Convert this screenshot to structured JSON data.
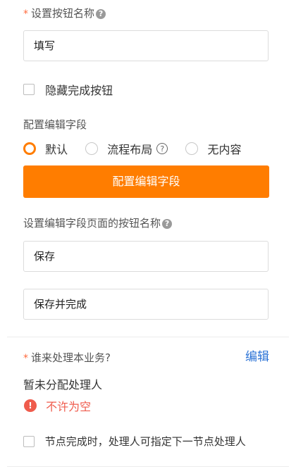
{
  "section_button_name": {
    "required_mark": "*",
    "label": "设置按钮名称",
    "help_icon": "question-circle-icon",
    "input_value": "填写"
  },
  "hide_complete": {
    "label": "隐藏完成按钮",
    "checked": false
  },
  "edit_fields": {
    "label": "配置编辑字段",
    "radios": [
      {
        "label": "默认",
        "checked": true
      },
      {
        "label": "流程布局",
        "checked": false,
        "help_icon": "question-circle-icon"
      },
      {
        "label": "无内容",
        "checked": false
      }
    ],
    "button_label": "配置编辑字段",
    "accent": "#ff7d00"
  },
  "edit_page_buttons": {
    "label": "设置编辑字段页面的按钮名称",
    "help_icon": "question-circle-icon",
    "inputs": [
      "保存",
      "保存并完成"
    ]
  },
  "handler": {
    "required_mark": "*",
    "question": "谁来处理本业务?",
    "edit_link": "编辑",
    "status": "暂未分配处理人",
    "error_icon": "exclamation-circle-icon",
    "error_text": "不许为空",
    "error_color": "#ef5b4c",
    "next_node": {
      "label": "节点完成时，处理人可指定下一节点处理人",
      "checked": false
    }
  }
}
